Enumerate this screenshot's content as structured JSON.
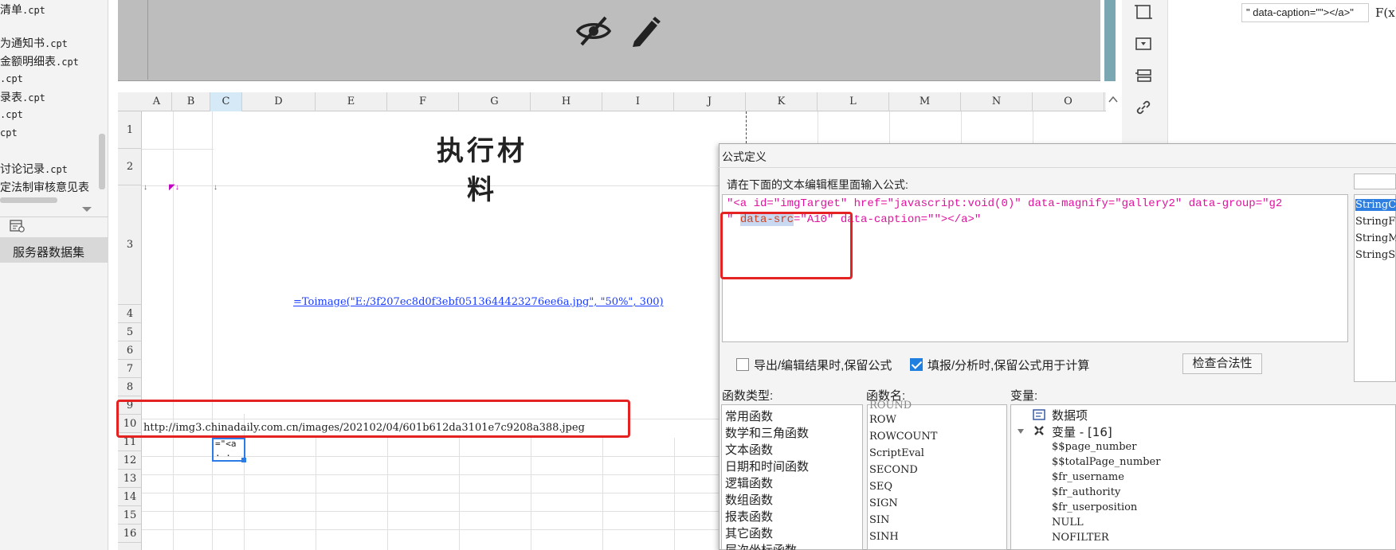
{
  "file_list": [
    {
      "name": "清单",
      "ext": ".cpt"
    },
    {
      "name": "为通知书",
      "ext": ".cpt"
    },
    {
      "name": "金额明细表",
      "ext": ".cpt"
    },
    {
      "name": "",
      "ext": ".cpt"
    },
    {
      "name": "录表",
      "ext": ".cpt"
    },
    {
      "name": "",
      "ext": ".cpt"
    },
    {
      "name": "",
      "ext": "cpt"
    },
    {
      "name": "讨论记录",
      "ext": ".cpt"
    },
    {
      "name": "定法制审核意见表",
      "ext": ""
    }
  ],
  "dataset": {
    "label": "服务器数据集"
  },
  "sheet": {
    "columns": [
      "A",
      "B",
      "C",
      "D",
      "E",
      "F",
      "G",
      "H",
      "I",
      "J",
      "K",
      "L",
      "M",
      "N",
      "O"
    ],
    "selected_column": "C",
    "rows": [
      "1",
      "2",
      "3",
      "4",
      "5",
      "6",
      "7",
      "8",
      "9",
      "10",
      "11",
      "12",
      "13",
      "14",
      "15",
      "16"
    ],
    "title": "执行材料",
    "formula_link": "=Toimage(\"E:/3f207ec8d0f3ebf0513644423276ee6a.jpg\", \"50%\", 300)",
    "url_cell": "http://img3.chinadaily.com.cn/images/202102/04/601b612da3101e7c9208a388.jpeg",
    "c11_line1": "=\"<a",
    "c11_line2": ". ."
  },
  "right_top_field": "\" data-caption=\"\"></a>\"",
  "right_fx_label": "F(x)",
  "dialog": {
    "title": "公式定义",
    "instruction": "请在下面的文本编辑框里面输入公式:",
    "formula": {
      "line1": "\"<a id=\"imgTarget\" href=\"javascript:void(0)\" data-magnify=\"gallery2\" data-group=\"g2",
      "line2_pre": "\" ",
      "line2_sel": "data-src",
      "line2_post": "=\"A10\" data-caption=\"\"></a>\""
    },
    "string_functions": [
      "StringC",
      "StringF",
      "StringM",
      "StringS"
    ],
    "checkbox_export": {
      "label": "导出/编辑结果时,保留公式",
      "checked": false
    },
    "checkbox_fill": {
      "label": "填报/分析时,保留公式用于计算",
      "checked": true
    },
    "validate_button": "检查合法性",
    "function_type_label": "函数类型:",
    "function_name_label": "函数名:",
    "variable_label": "变量:",
    "function_types": [
      "常用函数",
      "数学和三角函数",
      "文本函数",
      "日期和时间函数",
      "逻辑函数",
      "数组函数",
      "报表函数",
      "其它函数",
      "层次坐标函数"
    ],
    "function_names": [
      "ROUND",
      "ROW",
      "ROWCOUNT",
      "ScriptEval",
      "SECOND",
      "SEQ",
      "SIGN",
      "SIN",
      "SINH"
    ],
    "variables": {
      "data_items": "数据项",
      "var_group": "变量 - [16]",
      "items": [
        "$$page_number",
        "$$totalPage_number",
        "$fr_username",
        "$fr_authority",
        "$fr_userposition",
        "NULL",
        "NOFILTER"
      ]
    }
  },
  "colors": {
    "accent": "#2d7be5",
    "highlight_red": "#e52222",
    "link_blue": "#1a3cff",
    "string_magenta": "#e0129e"
  }
}
